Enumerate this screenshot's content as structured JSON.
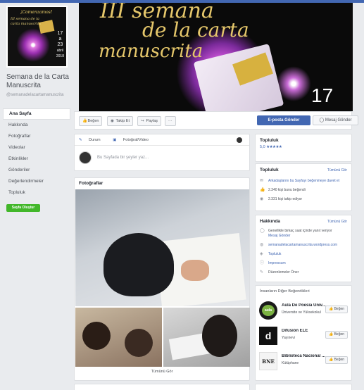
{
  "page": {
    "name": "Semana de la Carta Manuscrita",
    "handle": "@semanadelacartamanuscrita",
    "profile_pic": {
      "title": "¡Comenzamos!",
      "subtitle": "III semana de la carta manuscrita",
      "date_line1": "17",
      "date_line2": "a",
      "date_line3": "23",
      "date_line4": "abril",
      "date_line5": "2018"
    }
  },
  "cover": {
    "line1": "III semana",
    "line2": "de la carta",
    "line3": "manuscrita",
    "number": "17"
  },
  "nav": {
    "items": [
      {
        "label": "Ana Sayfa",
        "active": true
      },
      {
        "label": "Hakkında"
      },
      {
        "label": "Fotoğraflar"
      },
      {
        "label": "Videolar"
      },
      {
        "label": "Etkinlikler"
      },
      {
        "label": "Gönderiler"
      },
      {
        "label": "Değerlendirmeler"
      },
      {
        "label": "Topluluk"
      }
    ],
    "create_button": "Sayfa Oluştur"
  },
  "actions": {
    "like": "Beğen",
    "follow": "Takip Et",
    "share": "Paylaş",
    "more": "···",
    "email": "E-posta Gönder",
    "message": "Mesaj Gönder"
  },
  "composer": {
    "tab_status": "Durum",
    "tab_photo": "Fotoğraf/Video",
    "placeholder": "Bu Sayfada bir şeyler yaz..."
  },
  "photos": {
    "title": "Fotoğraflar",
    "see_all": "Tümünü Gör"
  },
  "reviews": {
    "title": "Topluluk",
    "rating": "5,0",
    "stars": "★★★★★"
  },
  "community": {
    "title": "Topluluk",
    "see_all": "Tümünü Gör",
    "invite": "Arkadaşlarını bu Sayfayı beğenmeye davet et",
    "likes": "2.340 kişi bunu beğendi",
    "follows": "2.331 kişi takip ediyor"
  },
  "about": {
    "title": "Hakkında",
    "see_all": "Tümünü Gör",
    "response": "Genellikle birkaç saat içinde yanıt veriyor",
    "message": "Mesaj Gönder",
    "website": "semanadelacartamanuscrita.wordpress.com",
    "category1": "Topluluk",
    "category2": "Impressum",
    "suggest": "Düzenlemeler Öner"
  },
  "liked_pages": {
    "title": "İnsanların Diğer Beğendikleri",
    "like_label": "Beğen",
    "items": [
      {
        "name": "Aula De Poesía Univ...",
        "category": "Üniversite ve Yüksekokul",
        "logo_text": "aula"
      },
      {
        "name": "Difusión ELE",
        "category": "Yayınevi",
        "logo_text": "d"
      },
      {
        "name": "Biblioteca Nacional ...",
        "category": "Kütüphane",
        "logo_text": "BNE"
      }
    ]
  },
  "colors": {
    "brand_blue": "#4267b2",
    "create_green": "#42b72a",
    "background": "#e9ebee"
  }
}
